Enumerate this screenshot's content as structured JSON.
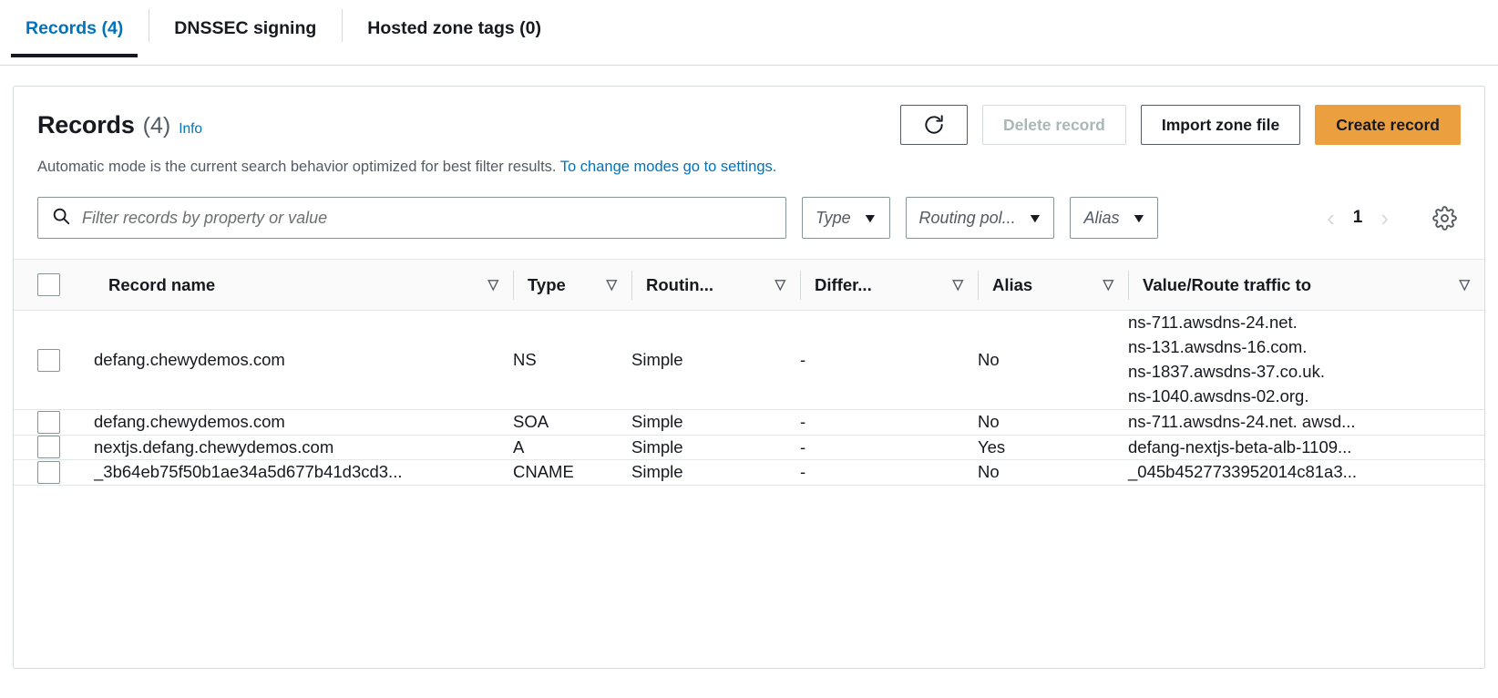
{
  "tabs": [
    {
      "label": "Records (4)",
      "active": true
    },
    {
      "label": "DNSSEC signing",
      "active": false
    },
    {
      "label": "Hosted zone tags (0)",
      "active": false
    }
  ],
  "panel": {
    "title": "Records",
    "count": "(4)",
    "info_label": "Info",
    "mode_note_text": "Automatic mode is the current search behavior optimized for best filter results.",
    "mode_note_link": "To change modes go to settings."
  },
  "toolbar": {
    "refresh_icon": "refresh-icon",
    "delete_label": "Delete record",
    "import_label": "Import zone file",
    "create_label": "Create record",
    "create_color": "#ec9f3f"
  },
  "filters": {
    "search_placeholder": "Filter records by property or value",
    "search_value": "",
    "search_icon": "search-icon",
    "type_label": "Type",
    "routing_label": "Routing pol...",
    "alias_label": "Alias",
    "caret_icon": "chevron-down-icon"
  },
  "pagination": {
    "prev_icon": "chevron-left-icon",
    "page": "1",
    "next_icon": "chevron-right-icon",
    "settings_icon": "gear-icon"
  },
  "table": {
    "columns": [
      {
        "label": "Record name",
        "sortable": true
      },
      {
        "label": "Type",
        "sortable": true
      },
      {
        "label": "Routin...",
        "sortable": true
      },
      {
        "label": "Differ...",
        "sortable": true
      },
      {
        "label": "Alias",
        "sortable": true
      },
      {
        "label": "Value/Route traffic to",
        "sortable": true
      }
    ],
    "sort_icon": "sort-descending-icon",
    "rows": [
      {
        "name": "defang.chewydemos.com",
        "type": "NS",
        "routing": "Simple",
        "differentiator": "-",
        "alias": "No",
        "values": [
          "ns-711.awsdns-24.net.",
          "ns-131.awsdns-16.com.",
          "ns-1837.awsdns-37.co.uk.",
          "ns-1040.awsdns-02.org."
        ]
      },
      {
        "name": "defang.chewydemos.com",
        "type": "SOA",
        "routing": "Simple",
        "differentiator": "-",
        "alias": "No",
        "values": [
          "ns-711.awsdns-24.net. awsd..."
        ]
      },
      {
        "name": "nextjs.defang.chewydemos.com",
        "type": "A",
        "routing": "Simple",
        "differentiator": "-",
        "alias": "Yes",
        "values": [
          "defang-nextjs-beta-alb-1109..."
        ]
      },
      {
        "name": "_3b64eb75f50b1ae34a5d677b41d3cd3...",
        "type": "CNAME",
        "routing": "Simple",
        "differentiator": "-",
        "alias": "No",
        "values": [
          "_045b4527733952014c81a3..."
        ]
      }
    ]
  }
}
